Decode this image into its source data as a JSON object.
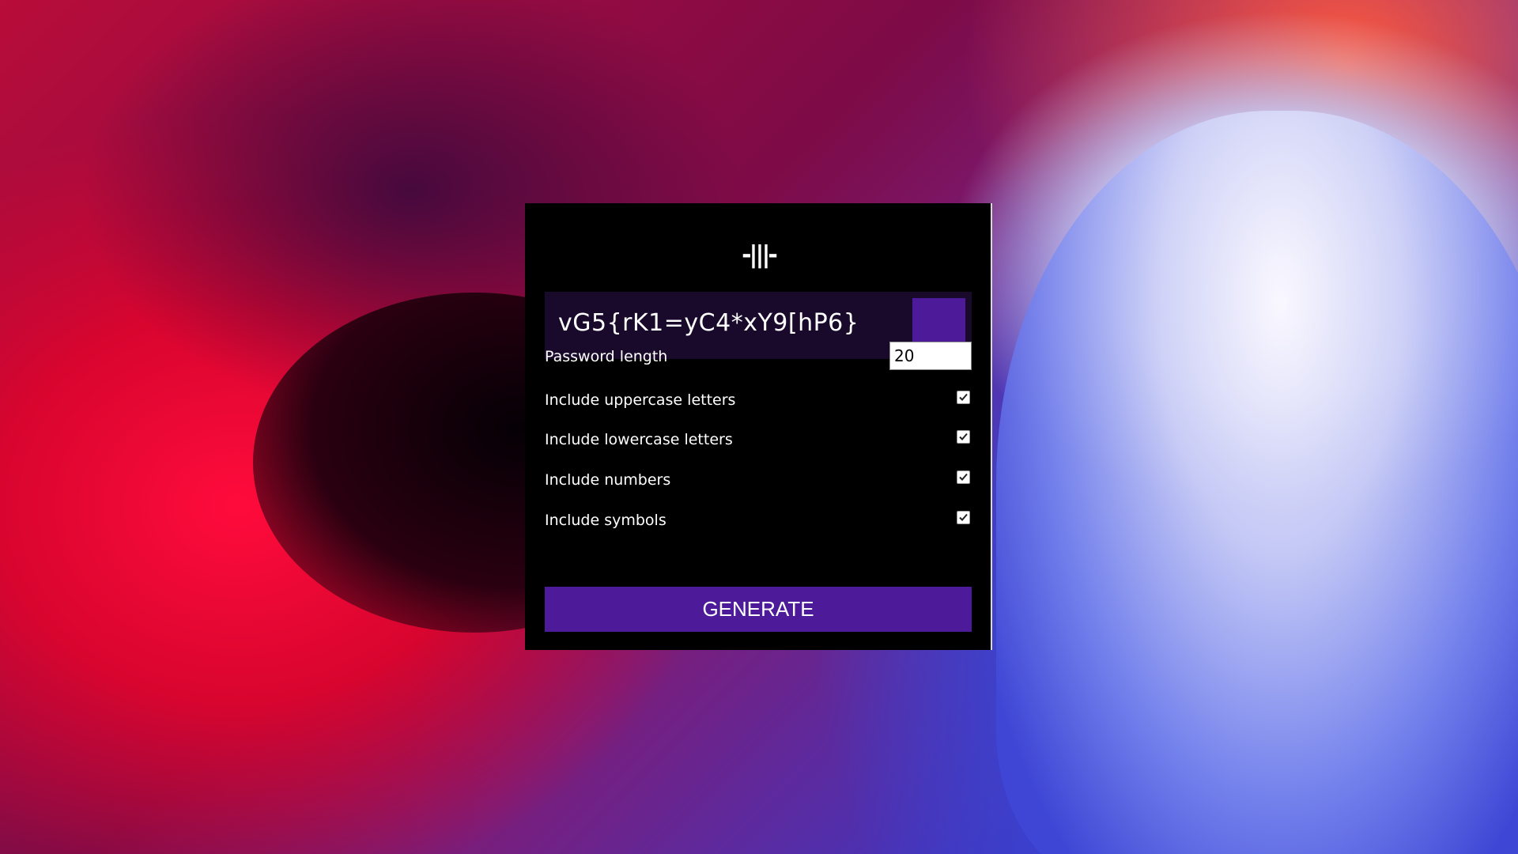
{
  "app": {
    "logo_text": "-|||-"
  },
  "password": {
    "value": "vG5{rK1=yC4*xY9[hP6}"
  },
  "length": {
    "label": "Password length",
    "value": "20"
  },
  "options": [
    {
      "label": "Include uppercase letters",
      "checked": true
    },
    {
      "label": "Include lowercase letters",
      "checked": true
    },
    {
      "label": "Include numbers",
      "checked": true
    },
    {
      "label": "Include symbols",
      "checked": true
    }
  ],
  "generate_label": "GENERATE",
  "colors": {
    "accent": "#4d1a99",
    "card_bg": "#000000",
    "password_box_bg": "#190a2c"
  },
  "icons": {
    "copy_button": "copy-icon",
    "checkbox": "checkmark-icon"
  }
}
